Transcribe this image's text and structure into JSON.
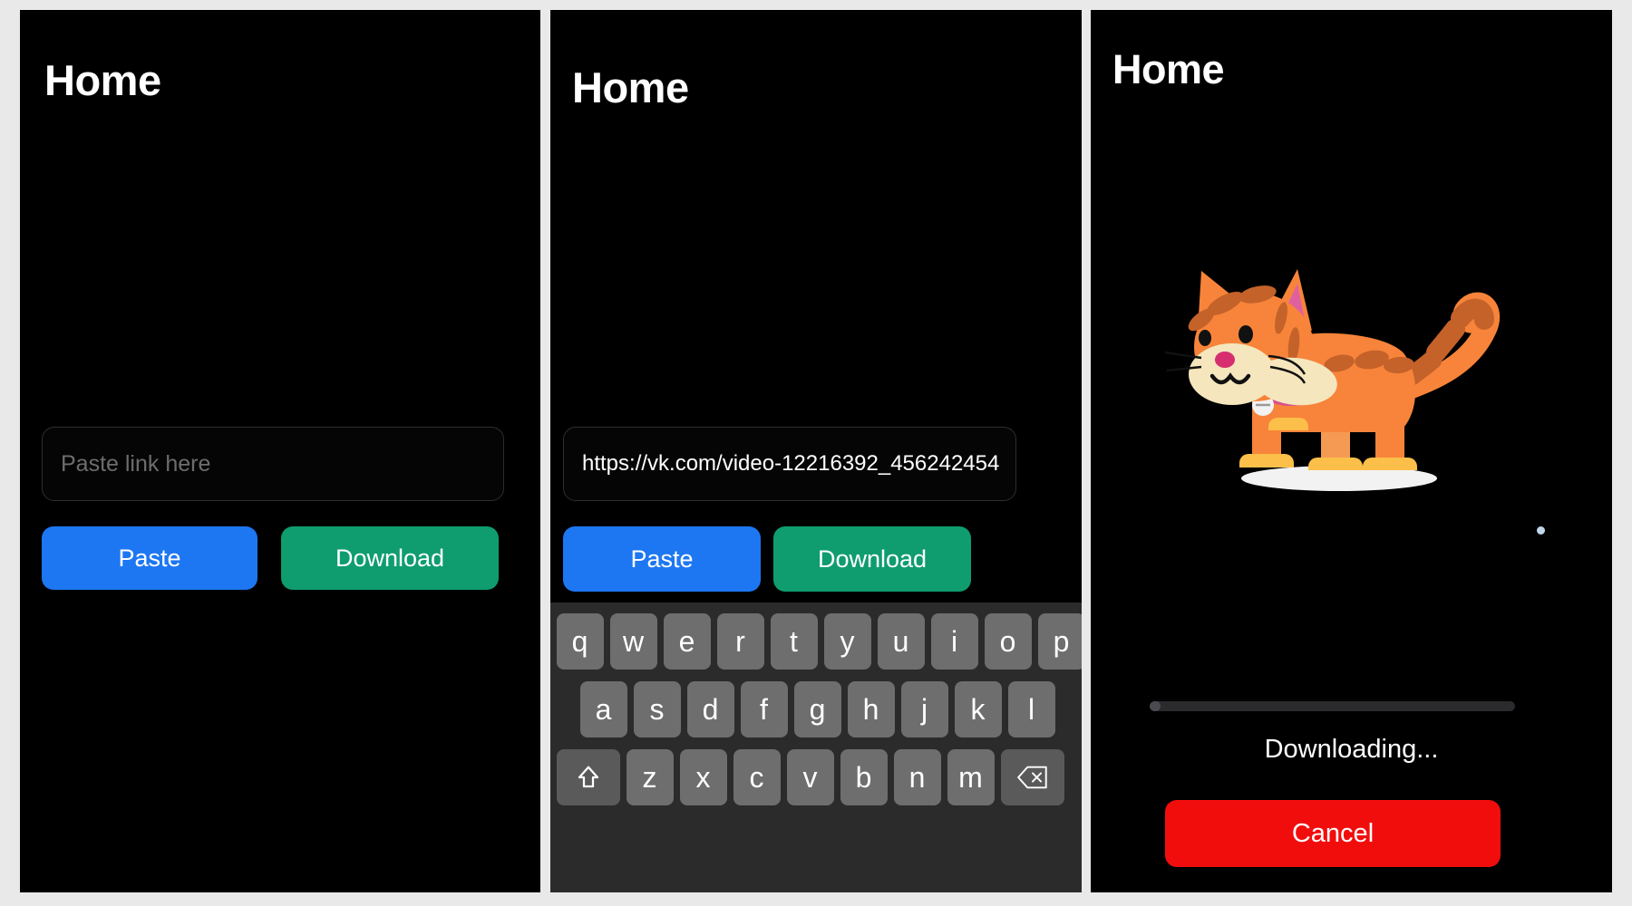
{
  "panels": [
    {
      "id": "panel-1",
      "state_name": "empty-input",
      "title": "Home",
      "input": {
        "value": "",
        "placeholder": "Paste link here"
      },
      "buttons": {
        "paste": "Paste",
        "download": "Download"
      }
    },
    {
      "id": "panel-2",
      "state_name": "url-entered-keyboard-open",
      "title": "Home",
      "input": {
        "value": "https://vk.com/video-12216392_456242454",
        "placeholder": "Paste link here"
      },
      "buttons": {
        "paste": "Paste",
        "download": "Download"
      },
      "keyboard": {
        "row1": [
          "q",
          "w",
          "e",
          "r",
          "t",
          "y",
          "u",
          "i",
          "o",
          "p"
        ],
        "row2": [
          "a",
          "s",
          "d",
          "f",
          "g",
          "h",
          "j",
          "k",
          "l"
        ],
        "row3_letters": [
          "z",
          "x",
          "c",
          "v",
          "b",
          "n",
          "m"
        ],
        "shift_key": "shift-icon",
        "backspace_key": "backspace-icon"
      }
    },
    {
      "id": "panel-3",
      "state_name": "downloading",
      "title": "Home",
      "illustration": "cat-illustration",
      "progress": {
        "percent": 3,
        "label": "Downloading..."
      },
      "buttons": {
        "cancel": "Cancel"
      }
    }
  ],
  "colors": {
    "background": "#e9e9e9",
    "screen": "#000000",
    "paste_blue": "#1d77f2",
    "download_green": "#0f9d6f",
    "cancel_red": "#f20d0d",
    "keyboard_bg": "#2b2b2b",
    "key_bg": "#6e6e6e",
    "key_special_bg": "#5a5a5a",
    "field_border": "#2e2e2e",
    "placeholder_text": "#6d6d6d",
    "progress_track": "#2b2b2e",
    "progress_fill": "#4a4a50",
    "cat_body": "#f7843a",
    "cat_stripe": "#c4622a",
    "cat_muzzle": "#f5e6bd",
    "cat_paw": "#fcbf49",
    "cat_ear_inner": "#e0609f",
    "cat_collar": "#d94d8c"
  }
}
